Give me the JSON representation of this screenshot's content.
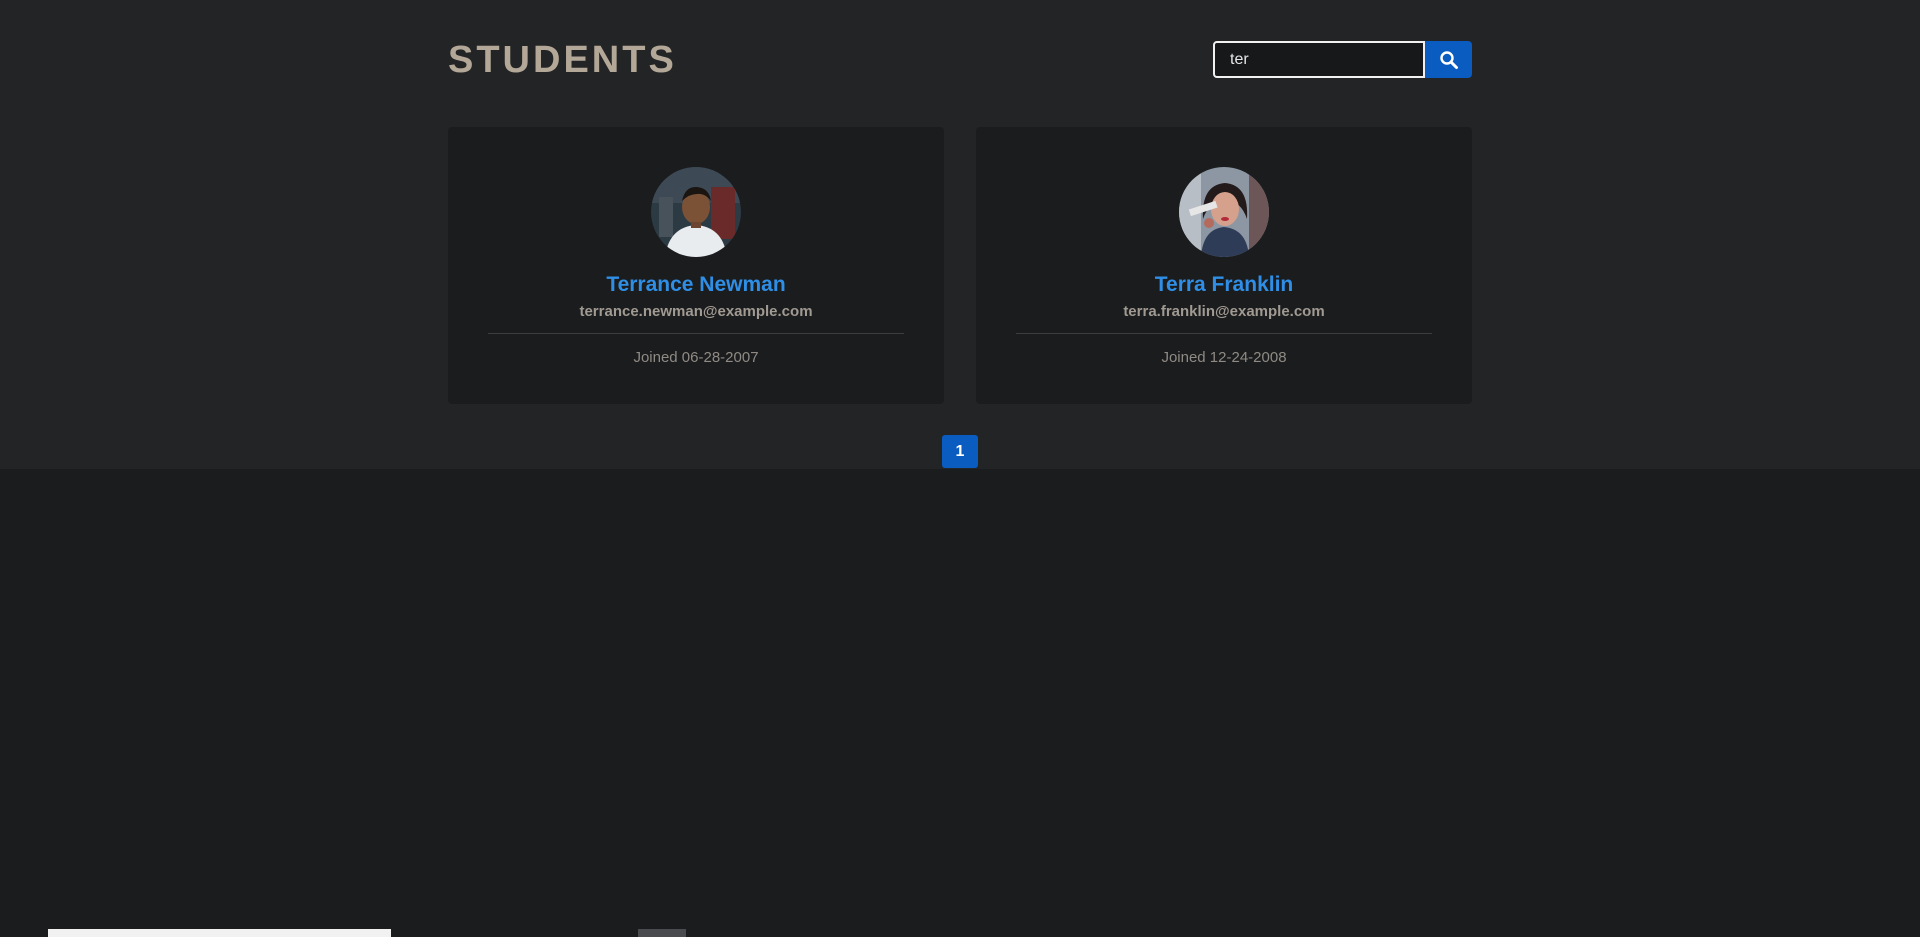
{
  "header": {
    "title": "STUDENTS"
  },
  "search": {
    "value": "ter",
    "icon": "search-icon"
  },
  "students": [
    {
      "name": "Terrance Newman",
      "email": "terrance.newman@example.com",
      "joined": "Joined 06-28-2007"
    },
    {
      "name": "Terra Franklin",
      "email": "terra.franklin@example.com",
      "joined": "Joined 12-24-2008"
    }
  ],
  "pagination": {
    "current": "1"
  },
  "colors": {
    "accent": "#0b5cc1",
    "name_link": "#2f8fe6",
    "title": "#b3a898"
  }
}
